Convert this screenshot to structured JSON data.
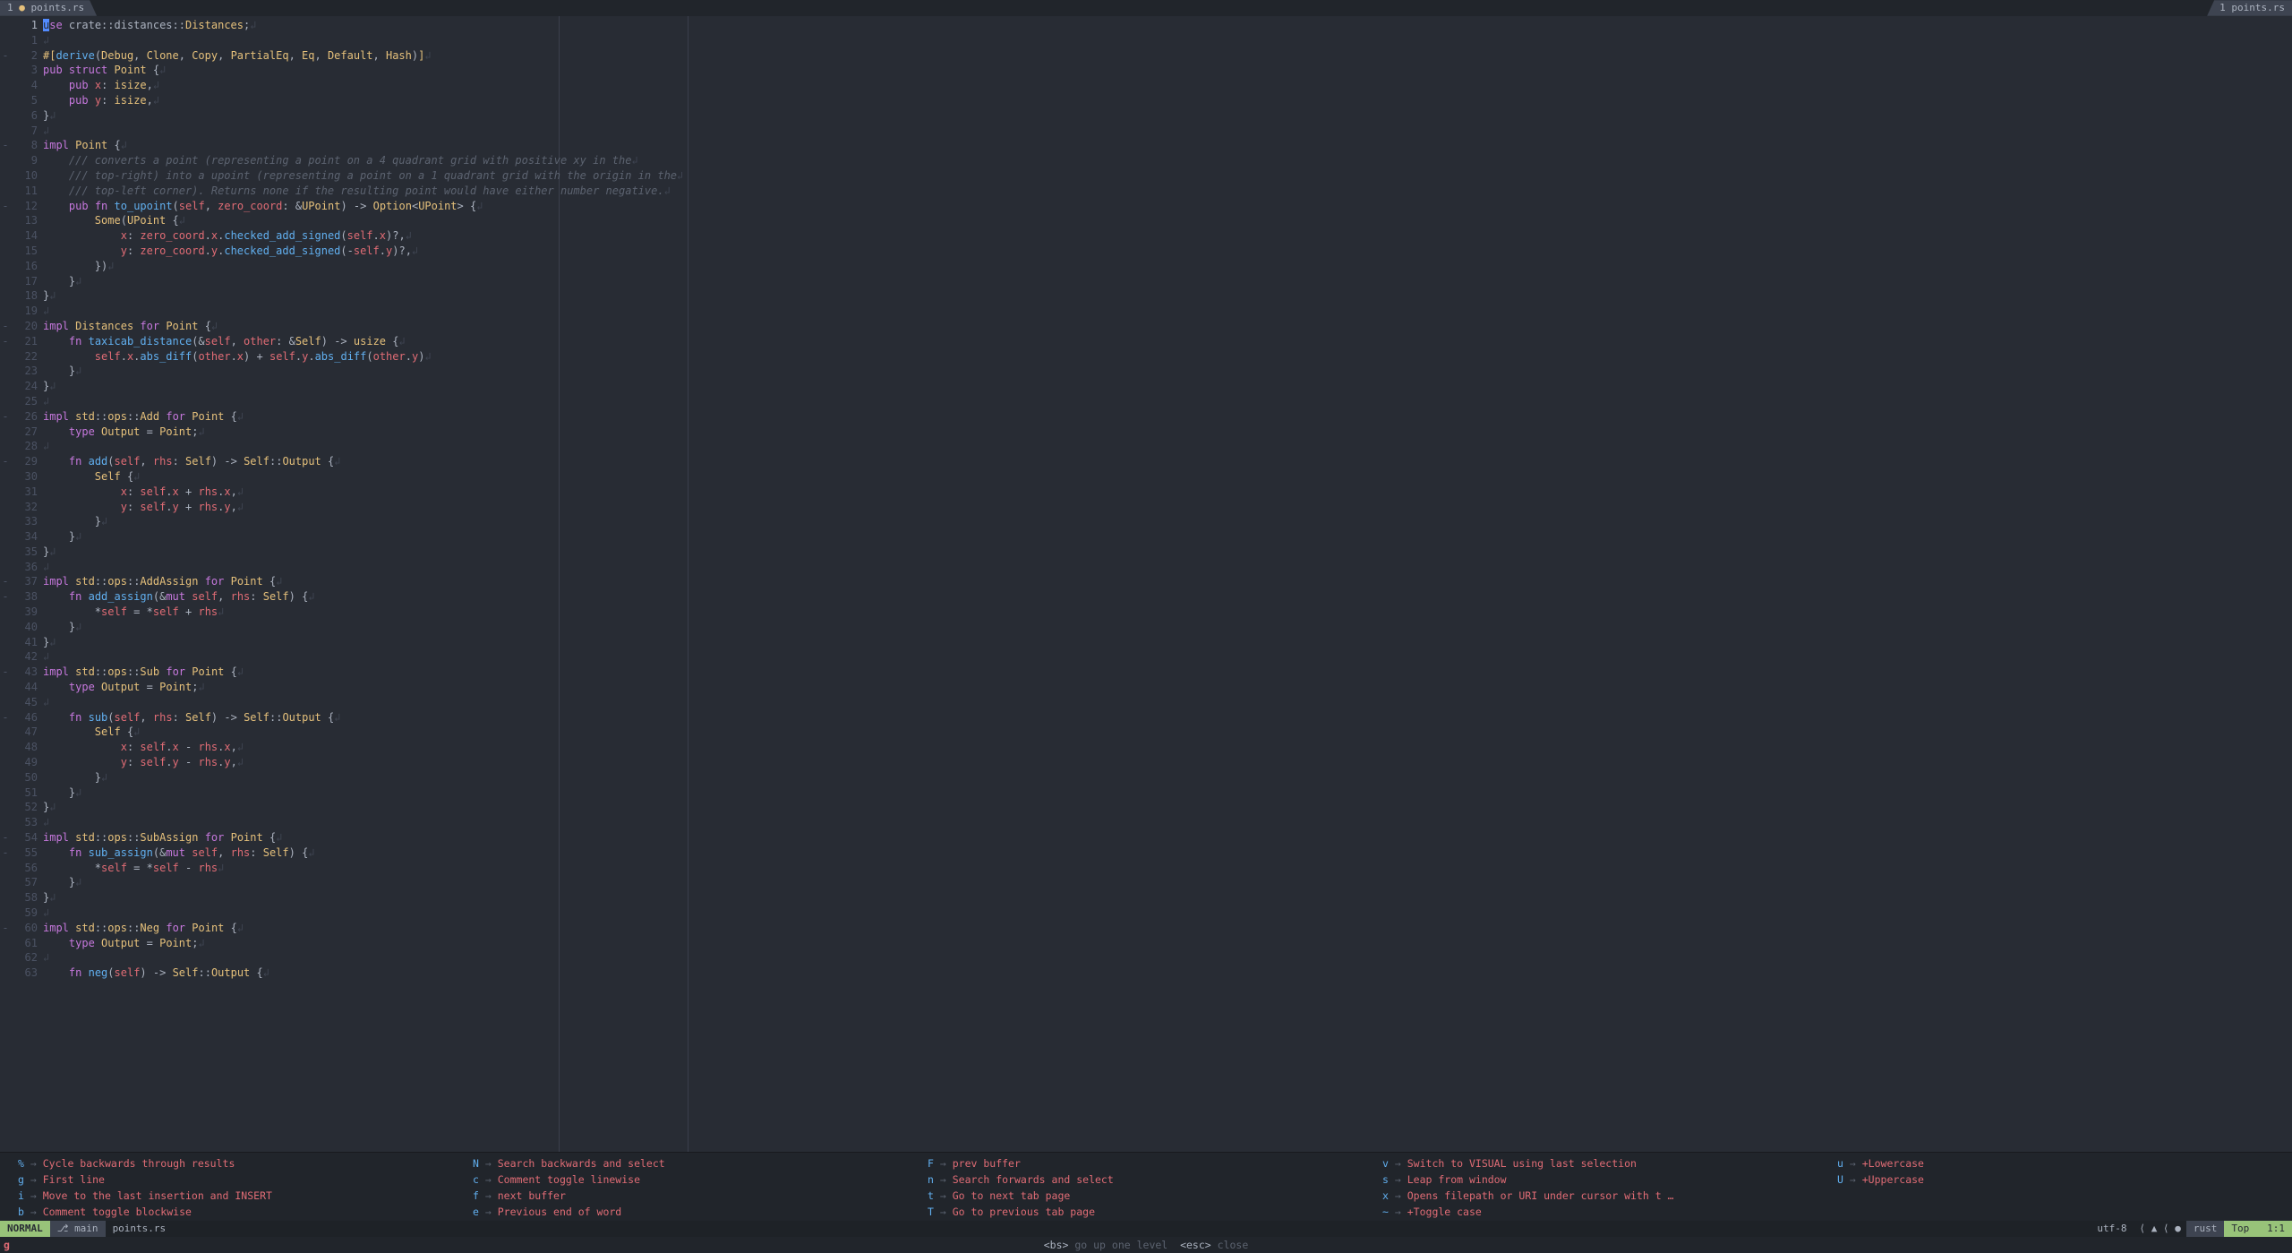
{
  "tabs": {
    "left": {
      "index": "1",
      "mod": "●",
      "name": "points.rs"
    },
    "right": {
      "index": "1",
      "name": "points.rs"
    }
  },
  "rulers": [
    80,
    100
  ],
  "lines": [
    {
      "n": 1,
      "fold": "",
      "html": "<span class='cursor'>u</span><span class='kw'>se</span> <span class='ns'>crate</span><span class='op'>::</span><span class='ns'>distances</span><span class='op'>::</span><span class='ty'>Distances</span>;<span class='nl'>↲</span>"
    },
    {
      "n": 1,
      "fold": "",
      "rel": true,
      "html": "<span class='nl'>↲</span>"
    },
    {
      "n": 2,
      "fold": "-",
      "rel": true,
      "html": "<span class='attr'>#[</span><span class='mc'>derive</span><span class='pn'>(</span><span class='ty'>Debug</span>, <span class='ty'>Clone</span>, <span class='ty'>Copy</span>, <span class='ty'>PartialEq</span>, <span class='ty'>Eq</span>, <span class='ty'>Default</span>, <span class='ty'>Hash</span><span class='pn'>)</span><span class='attr'>]</span><span class='nl'>↲</span>"
    },
    {
      "n": 3,
      "fold": "",
      "rel": true,
      "html": "<span class='kw'>pub</span> <span class='kw'>struct</span> <span class='ty'>Point</span> <span class='pn'>{</span><span class='nl'>↲</span>"
    },
    {
      "n": 4,
      "fold": "",
      "rel": true,
      "html": "    <span class='kw'>pub</span> <span class='fld'>x</span>: <span class='ty'>isize</span>,<span class='nl'>↲</span>"
    },
    {
      "n": 5,
      "fold": "",
      "rel": true,
      "html": "    <span class='kw'>pub</span> <span class='fld'>y</span>: <span class='ty'>isize</span>,<span class='nl'>↲</span>"
    },
    {
      "n": 6,
      "fold": "",
      "rel": true,
      "html": "<span class='pn'>}</span><span class='nl'>↲</span>"
    },
    {
      "n": 7,
      "fold": "",
      "rel": true,
      "html": "<span class='nl'>↲</span>"
    },
    {
      "n": 8,
      "fold": "-",
      "rel": true,
      "html": "<span class='kw'>impl</span> <span class='ty'>Point</span> <span class='pn'>{</span><span class='nl'>↲</span>"
    },
    {
      "n": 9,
      "fold": "",
      "rel": true,
      "html": "    <span class='cm'>/// converts a point (representing a point on a 4 quadrant grid with positive xy in the</span><span class='nl'>↲</span>"
    },
    {
      "n": 10,
      "fold": "",
      "rel": true,
      "html": "    <span class='cm'>/// top-right) into a upoint (representing a point on a 1 quadrant grid with the origin in the</span><span class='nl'>↲</span>"
    },
    {
      "n": 11,
      "fold": "",
      "rel": true,
      "html": "    <span class='cm'>/// top-left corner). Returns none if the resulting point would have either number negative.</span><span class='nl'>↲</span>"
    },
    {
      "n": 12,
      "fold": "-",
      "rel": true,
      "html": "    <span class='kw'>pub</span> <span class='kw'>fn</span> <span class='fn'>to_upoint</span><span class='pn'>(</span><span class='fld'>self</span>, <span class='fld'>zero_coord</span>: <span class='op'>&</span><span class='ty'>UPoint</span><span class='pn'>)</span> <span class='op'>-&gt;</span> <span class='ty'>Option</span><span class='op'>&lt;</span><span class='ty'>UPoint</span><span class='op'>&gt;</span> <span class='pn'>{</span><span class='nl'>↲</span>"
    },
    {
      "n": 13,
      "fold": "",
      "rel": true,
      "html": "        <span class='ty'>Some</span><span class='pn'>(</span><span class='ty'>UPoint</span> <span class='pn'>{</span><span class='nl'>↲</span>"
    },
    {
      "n": 14,
      "fold": "",
      "rel": true,
      "html": "            <span class='fld'>x</span>: <span class='fld'>zero_coord</span>.<span class='fld'>x</span>.<span class='fn'>checked_add_signed</span><span class='pn'>(</span><span class='fld'>self</span>.<span class='fld'>x</span><span class='pn'>)</span>?,<span class='nl'>↲</span>"
    },
    {
      "n": 15,
      "fold": "",
      "rel": true,
      "html": "            <span class='fld'>y</span>: <span class='fld'>zero_coord</span>.<span class='fld'>y</span>.<span class='fn'>checked_add_signed</span><span class='pn'>(</span><span class='op'>-</span><span class='fld'>self</span>.<span class='fld'>y</span><span class='pn'>)</span>?,<span class='nl'>↲</span>"
    },
    {
      "n": 16,
      "fold": "",
      "rel": true,
      "html": "        <span class='pn'>})</span><span class='nl'>↲</span>"
    },
    {
      "n": 17,
      "fold": "",
      "rel": true,
      "html": "    <span class='pn'>}</span><span class='nl'>↲</span>"
    },
    {
      "n": 18,
      "fold": "",
      "rel": true,
      "html": "<span class='pn'>}</span><span class='nl'>↲</span>"
    },
    {
      "n": 19,
      "fold": "",
      "rel": true,
      "html": "<span class='nl'>↲</span>"
    },
    {
      "n": 20,
      "fold": "-",
      "rel": true,
      "html": "<span class='kw'>impl</span> <span class='ty'>Distances</span> <span class='kw'>for</span> <span class='ty'>Point</span> <span class='pn'>{</span><span class='nl'>↲</span>"
    },
    {
      "n": 21,
      "fold": "-",
      "rel": true,
      "html": "    <span class='kw'>fn</span> <span class='fn'>taxicab_distance</span><span class='pn'>(</span><span class='op'>&</span><span class='fld'>self</span>, <span class='fld'>other</span>: <span class='op'>&</span><span class='ty'>Self</span><span class='pn'>)</span> <span class='op'>-&gt;</span> <span class='ty'>usize</span> <span class='pn'>{</span><span class='nl'>↲</span>"
    },
    {
      "n": 22,
      "fold": "",
      "rel": true,
      "html": "        <span class='fld'>self</span>.<span class='fld'>x</span>.<span class='fn'>abs_diff</span><span class='pn'>(</span><span class='fld'>other</span>.<span class='fld'>x</span><span class='pn'>)</span> <span class='op'>+</span> <span class='fld'>self</span>.<span class='fld'>y</span>.<span class='fn'>abs_diff</span><span class='pn'>(</span><span class='fld'>other</span>.<span class='fld'>y</span><span class='pn'>)</span><span class='nl'>↲</span>"
    },
    {
      "n": 23,
      "fold": "",
      "rel": true,
      "html": "    <span class='pn'>}</span><span class='nl'>↲</span>"
    },
    {
      "n": 24,
      "fold": "",
      "rel": true,
      "html": "<span class='pn'>}</span><span class='nl'>↲</span>"
    },
    {
      "n": 25,
      "fold": "",
      "rel": true,
      "html": "<span class='nl'>↲</span>"
    },
    {
      "n": 26,
      "fold": "-",
      "rel": true,
      "html": "<span class='kw'>impl</span> <span class='ns2'>std</span><span class='op'>::</span><span class='ns2'>ops</span><span class='op'>::</span><span class='ty'>Add</span> <span class='kw'>for</span> <span class='ty'>Point</span> <span class='pn'>{</span><span class='nl'>↲</span>"
    },
    {
      "n": 27,
      "fold": "",
      "rel": true,
      "html": "    <span class='kw'>type</span> <span class='ty'>Output</span> <span class='op'>=</span> <span class='ty'>Point</span>;<span class='nl'>↲</span>"
    },
    {
      "n": 28,
      "fold": "",
      "rel": true,
      "html": "<span class='nl'>↲</span>"
    },
    {
      "n": 29,
      "fold": "-",
      "rel": true,
      "html": "    <span class='kw'>fn</span> <span class='fn'>add</span><span class='pn'>(</span><span class='fld'>self</span>, <span class='fld'>rhs</span>: <span class='ty'>Self</span><span class='pn'>)</span> <span class='op'>-&gt;</span> <span class='ty'>Self</span><span class='op'>::</span><span class='ty'>Output</span> <span class='pn'>{</span><span class='nl'>↲</span>"
    },
    {
      "n": 30,
      "fold": "",
      "rel": true,
      "html": "        <span class='ty'>Self</span> <span class='pn'>{</span><span class='nl'>↲</span>"
    },
    {
      "n": 31,
      "fold": "",
      "rel": true,
      "html": "            <span class='fld'>x</span>: <span class='fld'>self</span>.<span class='fld'>x</span> <span class='op'>+</span> <span class='fld'>rhs</span>.<span class='fld'>x</span>,<span class='nl'>↲</span>"
    },
    {
      "n": 32,
      "fold": "",
      "rel": true,
      "html": "            <span class='fld'>y</span>: <span class='fld'>self</span>.<span class='fld'>y</span> <span class='op'>+</span> <span class='fld'>rhs</span>.<span class='fld'>y</span>,<span class='nl'>↲</span>"
    },
    {
      "n": 33,
      "fold": "",
      "rel": true,
      "html": "        <span class='pn'>}</span><span class='nl'>↲</span>"
    },
    {
      "n": 34,
      "fold": "",
      "rel": true,
      "html": "    <span class='pn'>}</span><span class='nl'>↲</span>"
    },
    {
      "n": 35,
      "fold": "",
      "rel": true,
      "html": "<span class='pn'>}</span><span class='nl'>↲</span>"
    },
    {
      "n": 36,
      "fold": "",
      "rel": true,
      "html": "<span class='nl'>↲</span>"
    },
    {
      "n": 37,
      "fold": "-",
      "rel": true,
      "html": "<span class='kw'>impl</span> <span class='ns2'>std</span><span class='op'>::</span><span class='ns2'>ops</span><span class='op'>::</span><span class='ty'>AddAssign</span> <span class='kw'>for</span> <span class='ty'>Point</span> <span class='pn'>{</span><span class='nl'>↲</span>"
    },
    {
      "n": 38,
      "fold": "-",
      "rel": true,
      "html": "    <span class='kw'>fn</span> <span class='fn'>add_assign</span><span class='pn'>(</span><span class='op'>&</span><span class='kw'>mut</span> <span class='fld'>self</span>, <span class='fld'>rhs</span>: <span class='ty'>Self</span><span class='pn'>)</span> <span class='pn'>{</span><span class='nl'>↲</span>"
    },
    {
      "n": 39,
      "fold": "",
      "rel": true,
      "html": "        <span class='op'>*</span><span class='fld'>self</span> <span class='op'>=</span> <span class='op'>*</span><span class='fld'>self</span> <span class='op'>+</span> <span class='fld'>rhs</span><span class='nl'>↲</span>"
    },
    {
      "n": 40,
      "fold": "",
      "rel": true,
      "html": "    <span class='pn'>}</span><span class='nl'>↲</span>"
    },
    {
      "n": 41,
      "fold": "",
      "rel": true,
      "html": "<span class='pn'>}</span><span class='nl'>↲</span>"
    },
    {
      "n": 42,
      "fold": "",
      "rel": true,
      "html": "<span class='nl'>↲</span>"
    },
    {
      "n": 43,
      "fold": "-",
      "rel": true,
      "html": "<span class='kw'>impl</span> <span class='ns2'>std</span><span class='op'>::</span><span class='ns2'>ops</span><span class='op'>::</span><span class='ty'>Sub</span> <span class='kw'>for</span> <span class='ty'>Point</span> <span class='pn'>{</span><span class='nl'>↲</span>"
    },
    {
      "n": 44,
      "fold": "",
      "rel": true,
      "html": "    <span class='kw'>type</span> <span class='ty'>Output</span> <span class='op'>=</span> <span class='ty'>Point</span>;<span class='nl'>↲</span>"
    },
    {
      "n": 45,
      "fold": "",
      "rel": true,
      "html": "<span class='nl'>↲</span>"
    },
    {
      "n": 46,
      "fold": "-",
      "rel": true,
      "html": "    <span class='kw'>fn</span> <span class='fn'>sub</span><span class='pn'>(</span><span class='fld'>self</span>, <span class='fld'>rhs</span>: <span class='ty'>Self</span><span class='pn'>)</span> <span class='op'>-&gt;</span> <span class='ty'>Self</span><span class='op'>::</span><span class='ty'>Output</span> <span class='pn'>{</span><span class='nl'>↲</span>"
    },
    {
      "n": 47,
      "fold": "",
      "rel": true,
      "html": "        <span class='ty'>Self</span> <span class='pn'>{</span><span class='nl'>↲</span>"
    },
    {
      "n": 48,
      "fold": "",
      "rel": true,
      "html": "            <span class='fld'>x</span>: <span class='fld'>self</span>.<span class='fld'>x</span> <span class='op'>-</span> <span class='fld'>rhs</span>.<span class='fld'>x</span>,<span class='nl'>↲</span>"
    },
    {
      "n": 49,
      "fold": "",
      "rel": true,
      "html": "            <span class='fld'>y</span>: <span class='fld'>self</span>.<span class='fld'>y</span> <span class='op'>-</span> <span class='fld'>rhs</span>.<span class='fld'>y</span>,<span class='nl'>↲</span>"
    },
    {
      "n": 50,
      "fold": "",
      "rel": true,
      "html": "        <span class='pn'>}</span><span class='nl'>↲</span>"
    },
    {
      "n": 51,
      "fold": "",
      "rel": true,
      "html": "    <span class='pn'>}</span><span class='nl'>↲</span>"
    },
    {
      "n": 52,
      "fold": "",
      "rel": true,
      "html": "<span class='pn'>}</span><span class='nl'>↲</span>"
    },
    {
      "n": 53,
      "fold": "",
      "rel": true,
      "html": "<span class='nl'>↲</span>"
    },
    {
      "n": 54,
      "fold": "-",
      "rel": true,
      "html": "<span class='kw'>impl</span> <span class='ns2'>std</span><span class='op'>::</span><span class='ns2'>ops</span><span class='op'>::</span><span class='ty'>SubAssign</span> <span class='kw'>for</span> <span class='ty'>Point</span> <span class='pn'>{</span><span class='nl'>↲</span>"
    },
    {
      "n": 55,
      "fold": "-",
      "rel": true,
      "html": "    <span class='kw'>fn</span> <span class='fn'>sub_assign</span><span class='pn'>(</span><span class='op'>&</span><span class='kw'>mut</span> <span class='fld'>self</span>, <span class='fld'>rhs</span>: <span class='ty'>Self</span><span class='pn'>)</span> <span class='pn'>{</span><span class='nl'>↲</span>"
    },
    {
      "n": 56,
      "fold": "",
      "rel": true,
      "html": "        <span class='op'>*</span><span class='fld'>self</span> <span class='op'>=</span> <span class='op'>*</span><span class='fld'>self</span> <span class='op'>-</span> <span class='fld'>rhs</span><span class='nl'>↲</span>"
    },
    {
      "n": 57,
      "fold": "",
      "rel": true,
      "html": "    <span class='pn'>}</span><span class='nl'>↲</span>"
    },
    {
      "n": 58,
      "fold": "",
      "rel": true,
      "html": "<span class='pn'>}</span><span class='nl'>↲</span>"
    },
    {
      "n": 59,
      "fold": "",
      "rel": true,
      "html": "<span class='nl'>↲</span>"
    },
    {
      "n": 60,
      "fold": "-",
      "rel": true,
      "html": "<span class='kw'>impl</span> <span class='ns2'>std</span><span class='op'>::</span><span class='ns2'>ops</span><span class='op'>::</span><span class='ty'>Neg</span> <span class='kw'>for</span> <span class='ty'>Point</span> <span class='pn'>{</span><span class='nl'>↲</span>"
    },
    {
      "n": 61,
      "fold": "",
      "rel": true,
      "html": "    <span class='kw'>type</span> <span class='ty'>Output</span> <span class='op'>=</span> <span class='ty'>Point</span>;<span class='nl'>↲</span>"
    },
    {
      "n": 62,
      "fold": "",
      "rel": true,
      "html": "<span class='nl'>↲</span>"
    },
    {
      "n": 63,
      "fold": "",
      "rel": true,
      "html": "    <span class='kw'>fn</span> <span class='fn'>neg</span><span class='pn'>(</span><span class='fld'>self</span><span class='pn'>)</span> <span class='op'>-&gt;</span> <span class='ty'>Self</span><span class='op'>::</span><span class='ty'>Output</span> <span class='pn'>{</span><span class='nl'>↲</span>"
    }
  ],
  "help": [
    [
      {
        "k": "%",
        "d": "Cycle backwards through results"
      },
      {
        "k": "g",
        "d": "First line"
      },
      {
        "k": "i",
        "d": "Move to the last insertion and INSERT"
      },
      {
        "k": "b",
        "d": "Comment toggle blockwise"
      }
    ],
    [
      {
        "k": "N",
        "d": "Search backwards and select"
      },
      {
        "k": "c",
        "d": "Comment toggle linewise"
      },
      {
        "k": "f",
        "d": "next buffer"
      },
      {
        "k": "e",
        "d": "Previous end of word"
      }
    ],
    [
      {
        "k": "F",
        "d": "prev buffer"
      },
      {
        "k": "n",
        "d": "Search forwards and select"
      },
      {
        "k": "t",
        "d": "Go to next tab page"
      },
      {
        "k": "T",
        "d": "Go to previous tab page"
      }
    ],
    [
      {
        "k": "v",
        "d": "Switch to VISUAL using last selection"
      },
      {
        "k": "s",
        "d": "Leap from window"
      },
      {
        "k": "x",
        "d": "Opens filepath or URI under cursor with t …"
      },
      {
        "k": "~",
        "d": "+Toggle case"
      }
    ],
    [
      {
        "k": "u",
        "d": "+Lowercase"
      },
      {
        "k": "U",
        "d": "+Uppercase"
      }
    ]
  ],
  "status": {
    "mode": "NORMAL",
    "branch_icon": "⎇",
    "branch": "main",
    "file": "points.rs",
    "encoding": "utf-8",
    "diag": "⟨ ▲ ⟨ ●",
    "lang": "rust",
    "scroll": "Top",
    "pos": "1:1"
  },
  "cmd": {
    "prompt": "g",
    "center_bs": "<bs>",
    "center_bs_txt": "go up one level",
    "center_esc": "<esc>",
    "center_esc_txt": "close"
  }
}
